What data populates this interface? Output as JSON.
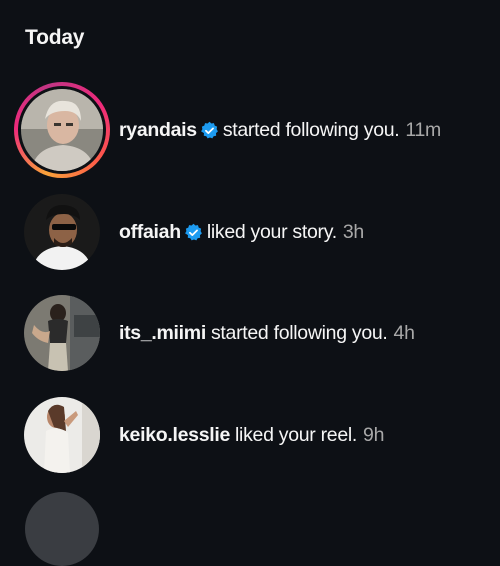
{
  "section": {
    "title": "Today"
  },
  "notifications": [
    {
      "username": "ryandais",
      "verified": true,
      "action": "started following you.",
      "time": "11m",
      "has_story": true,
      "avatar_icon": "profile-photo"
    },
    {
      "username": "offaiah",
      "verified": true,
      "action": "liked your story.",
      "time": "3h",
      "has_story": false,
      "avatar_icon": "profile-photo"
    },
    {
      "username": "its_.miimi",
      "verified": false,
      "action": "started following you.",
      "time": "4h",
      "has_story": false,
      "avatar_icon": "profile-photo"
    },
    {
      "username": "keiko.lesslie",
      "verified": false,
      "action": "liked your reel.",
      "time": "9h",
      "has_story": false,
      "avatar_icon": "profile-photo"
    }
  ],
  "colors": {
    "background": "#0d1015",
    "text": "#f5f5f5",
    "timestamp": "#a8a8a8",
    "verified_badge": "#1d9bf0"
  }
}
